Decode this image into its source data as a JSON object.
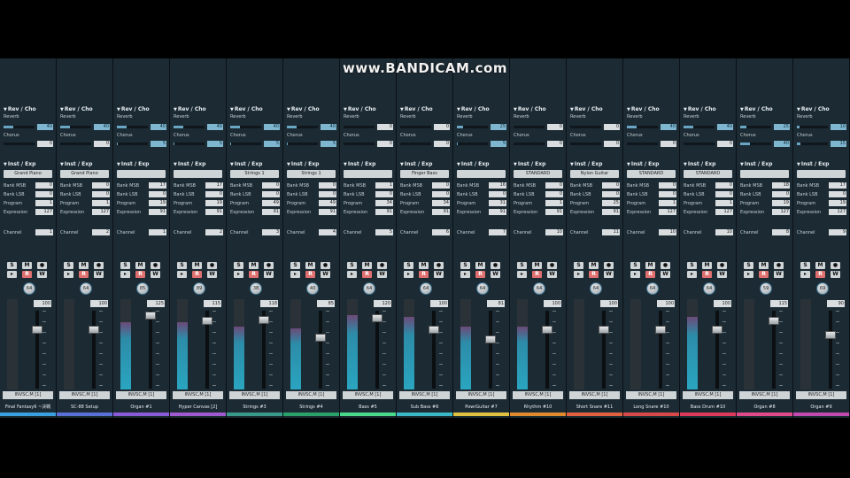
{
  "watermark": "www.BANDICAM.com",
  "labels": {
    "rev_cho": "Rev / Cho",
    "reverb": "Reverb",
    "chorus": "Chorus",
    "inst_exp": "Inst / Exp",
    "bank_msb": "Bank MSB",
    "bank_lsb": "Bank LSB",
    "program": "Program",
    "expression": "Expression",
    "channel": "Channel",
    "solo": "S",
    "mute": "M",
    "record": "R",
    "write": "W",
    "port": "INVSC,M [1]"
  },
  "strips": [
    {
      "name": "Final Fantasy6 ~決戦",
      "reverb": 40,
      "chorus": 0,
      "preset": "Grand Piano",
      "bank_msb": 0,
      "bank_lsb": 0,
      "program": 1,
      "expression": 127,
      "channel": 1,
      "pan": 64,
      "volume": 100,
      "level": 0.0,
      "color": "#3aa0e0"
    },
    {
      "name": "SC-88 Setup",
      "reverb": 40,
      "chorus": 0,
      "preset": "Grand Piano",
      "bank_msb": 0,
      "bank_lsb": 0,
      "program": 1,
      "expression": 127,
      "channel": 2,
      "pan": 64,
      "volume": 100,
      "level": 0.0,
      "color": "#5a6fd8"
    },
    {
      "name": "Organ #1",
      "reverb": 40,
      "chorus": 5,
      "preset": "",
      "bank_msb": 17,
      "bank_lsb": 0,
      "program": 19,
      "expression": 91,
      "channel": 1,
      "pan": 85,
      "volume": 125,
      "level": 0.75,
      "color": "#8a5bd8"
    },
    {
      "name": "Hyper Canvas [2]",
      "reverb": 40,
      "chorus": 5,
      "preset": "",
      "bank_msb": 17,
      "bank_lsb": 0,
      "program": 19,
      "expression": 91,
      "channel": 2,
      "pan": 89,
      "volume": 115,
      "level": 0.75,
      "color": "#a05ad0"
    },
    {
      "name": "Strings #3",
      "reverb": 40,
      "chorus": 5,
      "preset": "Strings 1",
      "bank_msb": 0,
      "bank_lsb": 0,
      "program": 49,
      "expression": 91,
      "channel": 3,
      "pan": 38,
      "volume": 118,
      "level": 0.7,
      "color": "#3a9a8a"
    },
    {
      "name": "Strings #4",
      "reverb": 40,
      "chorus": 5,
      "preset": "Strings 1",
      "bank_msb": 0,
      "bank_lsb": 0,
      "program": 49,
      "expression": 91,
      "channel": 4,
      "pan": 40,
      "volume": 85,
      "level": 0.68,
      "color": "#2aa06a"
    },
    {
      "name": "Bass #5",
      "reverb": 0,
      "chorus": 0,
      "preset": "",
      "bank_msb": 1,
      "bank_lsb": 0,
      "program": 34,
      "expression": 91,
      "channel": 5,
      "pan": 64,
      "volume": 120,
      "level": 0.82,
      "color": "#4ad88a"
    },
    {
      "name": "Sub Bass #6",
      "reverb": 0,
      "chorus": 0,
      "preset": "Finger Bass",
      "bank_msb": 0,
      "bank_lsb": 0,
      "program": 34,
      "expression": 91,
      "channel": 6,
      "pan": 64,
      "volume": 100,
      "level": 0.8,
      "color": "#3ab8c8"
    },
    {
      "name": "PowrGuitar #7",
      "reverb": 25,
      "chorus": 5,
      "preset": "",
      "bank_msb": 16,
      "bank_lsb": 0,
      "program": 31,
      "expression": 91,
      "channel": 7,
      "pan": 64,
      "volume": 81,
      "level": 0.7,
      "color": "#e0c040"
    },
    {
      "name": "Rhythm #10",
      "reverb": 0,
      "chorus": 0,
      "preset": "STANDARD",
      "bank_msb": 0,
      "bank_lsb": 0,
      "program": 1,
      "expression": 91,
      "channel": 10,
      "pan": 64,
      "volume": 100,
      "level": 0.7,
      "color": "#e08a30"
    },
    {
      "name": "Short Snare #11",
      "reverb": 0,
      "chorus": 0,
      "preset": "Nylon Guitar",
      "bank_msb": 0,
      "bank_lsb": 0,
      "program": 25,
      "expression": 91,
      "channel": 11,
      "pan": 64,
      "volume": 100,
      "level": 0.0,
      "color": "#e06040"
    },
    {
      "name": "Long Snare #10",
      "reverb": 40,
      "chorus": 0,
      "preset": "STANDARD",
      "bank_msb": 0,
      "bank_lsb": 0,
      "program": 1,
      "expression": 127,
      "channel": 10,
      "pan": 64,
      "volume": 100,
      "level": 0.0,
      "color": "#d84a4a"
    },
    {
      "name": "Bass Drum #10",
      "reverb": 40,
      "chorus": 0,
      "preset": "STANDARD",
      "bank_msb": 0,
      "bank_lsb": 0,
      "program": 1,
      "expression": 127,
      "channel": 10,
      "pan": 64,
      "volume": 100,
      "level": 0.8,
      "color": "#e03a5a"
    },
    {
      "name": "Organ #8",
      "reverb": 25,
      "chorus": 40,
      "preset": "",
      "bank_msb": 18,
      "bank_lsb": 0,
      "program": 19,
      "expression": 127,
      "channel": 8,
      "pan": 59,
      "volume": 115,
      "level": 0.0,
      "color": "#e04a8a"
    },
    {
      "name": "Organ #9",
      "reverb": 10,
      "chorus": 15,
      "preset": "",
      "bank_msb": 17,
      "bank_lsb": 0,
      "program": 19,
      "expression": 127,
      "channel": 9,
      "pan": 69,
      "volume": 90,
      "level": 0.0,
      "color": "#c04ab0"
    }
  ]
}
